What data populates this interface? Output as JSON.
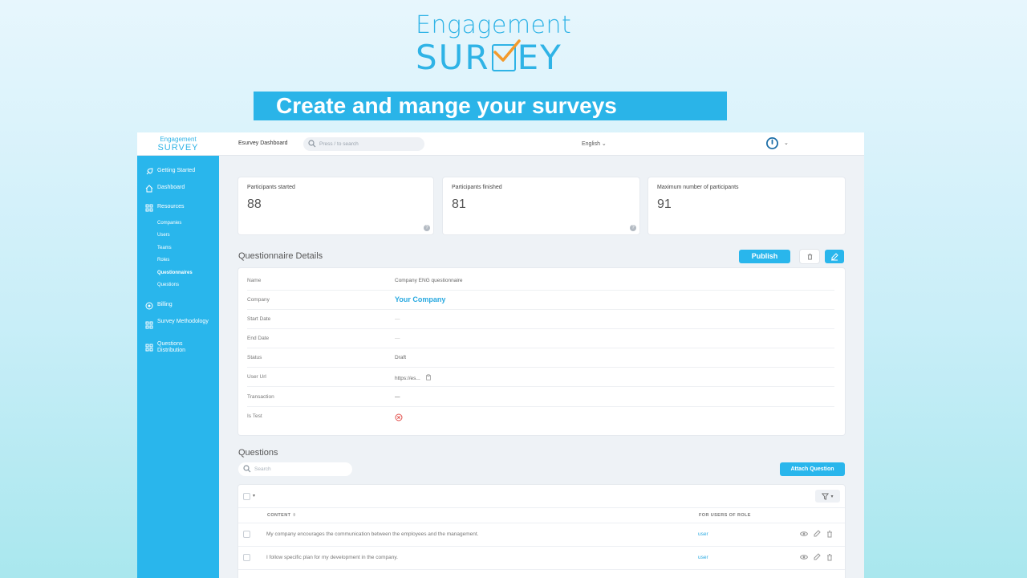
{
  "hero": {
    "logo_line1": "Engagement",
    "logo_line2_left": "SUR",
    "logo_line2_right": "EY",
    "banner": "Create and mange your surveys"
  },
  "topbar": {
    "mini_logo_line1": "Engagement",
    "mini_logo_line2": "SURVEY",
    "dashboard_title": "Esurvey Dashboard",
    "search_placeholder": "Press / to search",
    "language": "English",
    "caret": "⌄"
  },
  "sidebar": {
    "items": [
      {
        "label": "Getting Started",
        "icon": "rocket-icon"
      },
      {
        "label": "Dashboard",
        "icon": "home-icon"
      },
      {
        "label": "Resources",
        "icon": "grid-icon"
      },
      {
        "label": "Billing",
        "icon": "billing-icon"
      },
      {
        "label": "Survey Methodology",
        "icon": "grid-icon"
      },
      {
        "label": "Questions Distribution",
        "icon": "grid-icon"
      }
    ],
    "resources_sub": [
      "Companies",
      "Users",
      "Teams",
      "Roles",
      "Questionnaires",
      "Questions"
    ],
    "active_sub": "Questionnaires"
  },
  "stats": [
    {
      "label": "Participants started",
      "value": "88"
    },
    {
      "label": "Participants finished",
      "value": "81"
    },
    {
      "label": "Maximum number of participants",
      "value": "91"
    }
  ],
  "details": {
    "title": "Questionnaire Details",
    "publish_label": "Publish",
    "rows": [
      {
        "key": "Name",
        "value": "Company ENG questionnaire"
      },
      {
        "key": "Company",
        "value": "Your Company"
      },
      {
        "key": "Start Date",
        "value": "—"
      },
      {
        "key": "End Date",
        "value": "—"
      },
      {
        "key": "Status",
        "value": "Draft"
      },
      {
        "key": "User Url",
        "value": "https://es..."
      },
      {
        "key": "Transaction",
        "value": "—"
      },
      {
        "key": "Is Test",
        "value": ""
      }
    ]
  },
  "questions": {
    "title": "Questions",
    "search_placeholder": "Search",
    "attach_label": "Attach Question",
    "col_content": "CONTENT",
    "col_role": "FOR USERS OF ROLE",
    "rows": [
      {
        "content": "My company encourages the communication between the employees and the management.",
        "role": "user"
      },
      {
        "content": "I follow specific plan for my development in the company.",
        "role": "user"
      }
    ]
  },
  "colors": {
    "accent": "#29b6ec",
    "danger": "#e2504c"
  }
}
